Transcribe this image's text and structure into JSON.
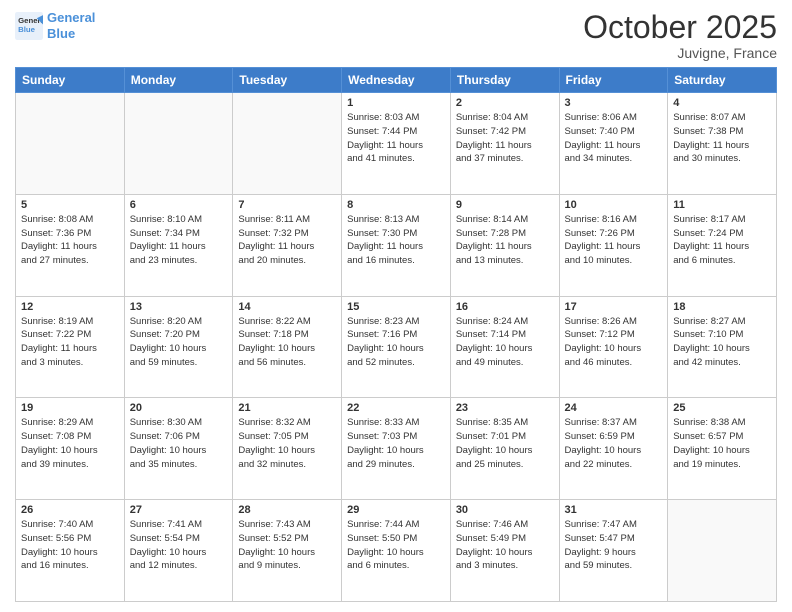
{
  "header": {
    "logo_line1": "General",
    "logo_line2": "Blue",
    "month": "October 2025",
    "location": "Juvigne, France"
  },
  "weekdays": [
    "Sunday",
    "Monday",
    "Tuesday",
    "Wednesday",
    "Thursday",
    "Friday",
    "Saturday"
  ],
  "weeks": [
    [
      {
        "day": "",
        "info": ""
      },
      {
        "day": "",
        "info": ""
      },
      {
        "day": "",
        "info": ""
      },
      {
        "day": "1",
        "info": "Sunrise: 8:03 AM\nSunset: 7:44 PM\nDaylight: 11 hours\nand 41 minutes."
      },
      {
        "day": "2",
        "info": "Sunrise: 8:04 AM\nSunset: 7:42 PM\nDaylight: 11 hours\nand 37 minutes."
      },
      {
        "day": "3",
        "info": "Sunrise: 8:06 AM\nSunset: 7:40 PM\nDaylight: 11 hours\nand 34 minutes."
      },
      {
        "day": "4",
        "info": "Sunrise: 8:07 AM\nSunset: 7:38 PM\nDaylight: 11 hours\nand 30 minutes."
      }
    ],
    [
      {
        "day": "5",
        "info": "Sunrise: 8:08 AM\nSunset: 7:36 PM\nDaylight: 11 hours\nand 27 minutes."
      },
      {
        "day": "6",
        "info": "Sunrise: 8:10 AM\nSunset: 7:34 PM\nDaylight: 11 hours\nand 23 minutes."
      },
      {
        "day": "7",
        "info": "Sunrise: 8:11 AM\nSunset: 7:32 PM\nDaylight: 11 hours\nand 20 minutes."
      },
      {
        "day": "8",
        "info": "Sunrise: 8:13 AM\nSunset: 7:30 PM\nDaylight: 11 hours\nand 16 minutes."
      },
      {
        "day": "9",
        "info": "Sunrise: 8:14 AM\nSunset: 7:28 PM\nDaylight: 11 hours\nand 13 minutes."
      },
      {
        "day": "10",
        "info": "Sunrise: 8:16 AM\nSunset: 7:26 PM\nDaylight: 11 hours\nand 10 minutes."
      },
      {
        "day": "11",
        "info": "Sunrise: 8:17 AM\nSunset: 7:24 PM\nDaylight: 11 hours\nand 6 minutes."
      }
    ],
    [
      {
        "day": "12",
        "info": "Sunrise: 8:19 AM\nSunset: 7:22 PM\nDaylight: 11 hours\nand 3 minutes."
      },
      {
        "day": "13",
        "info": "Sunrise: 8:20 AM\nSunset: 7:20 PM\nDaylight: 10 hours\nand 59 minutes."
      },
      {
        "day": "14",
        "info": "Sunrise: 8:22 AM\nSunset: 7:18 PM\nDaylight: 10 hours\nand 56 minutes."
      },
      {
        "day": "15",
        "info": "Sunrise: 8:23 AM\nSunset: 7:16 PM\nDaylight: 10 hours\nand 52 minutes."
      },
      {
        "day": "16",
        "info": "Sunrise: 8:24 AM\nSunset: 7:14 PM\nDaylight: 10 hours\nand 49 minutes."
      },
      {
        "day": "17",
        "info": "Sunrise: 8:26 AM\nSunset: 7:12 PM\nDaylight: 10 hours\nand 46 minutes."
      },
      {
        "day": "18",
        "info": "Sunrise: 8:27 AM\nSunset: 7:10 PM\nDaylight: 10 hours\nand 42 minutes."
      }
    ],
    [
      {
        "day": "19",
        "info": "Sunrise: 8:29 AM\nSunset: 7:08 PM\nDaylight: 10 hours\nand 39 minutes."
      },
      {
        "day": "20",
        "info": "Sunrise: 8:30 AM\nSunset: 7:06 PM\nDaylight: 10 hours\nand 35 minutes."
      },
      {
        "day": "21",
        "info": "Sunrise: 8:32 AM\nSunset: 7:05 PM\nDaylight: 10 hours\nand 32 minutes."
      },
      {
        "day": "22",
        "info": "Sunrise: 8:33 AM\nSunset: 7:03 PM\nDaylight: 10 hours\nand 29 minutes."
      },
      {
        "day": "23",
        "info": "Sunrise: 8:35 AM\nSunset: 7:01 PM\nDaylight: 10 hours\nand 25 minutes."
      },
      {
        "day": "24",
        "info": "Sunrise: 8:37 AM\nSunset: 6:59 PM\nDaylight: 10 hours\nand 22 minutes."
      },
      {
        "day": "25",
        "info": "Sunrise: 8:38 AM\nSunset: 6:57 PM\nDaylight: 10 hours\nand 19 minutes."
      }
    ],
    [
      {
        "day": "26",
        "info": "Sunrise: 7:40 AM\nSunset: 5:56 PM\nDaylight: 10 hours\nand 16 minutes."
      },
      {
        "day": "27",
        "info": "Sunrise: 7:41 AM\nSunset: 5:54 PM\nDaylight: 10 hours\nand 12 minutes."
      },
      {
        "day": "28",
        "info": "Sunrise: 7:43 AM\nSunset: 5:52 PM\nDaylight: 10 hours\nand 9 minutes."
      },
      {
        "day": "29",
        "info": "Sunrise: 7:44 AM\nSunset: 5:50 PM\nDaylight: 10 hours\nand 6 minutes."
      },
      {
        "day": "30",
        "info": "Sunrise: 7:46 AM\nSunset: 5:49 PM\nDaylight: 10 hours\nand 3 minutes."
      },
      {
        "day": "31",
        "info": "Sunrise: 7:47 AM\nSunset: 5:47 PM\nDaylight: 9 hours\nand 59 minutes."
      },
      {
        "day": "",
        "info": ""
      }
    ]
  ]
}
